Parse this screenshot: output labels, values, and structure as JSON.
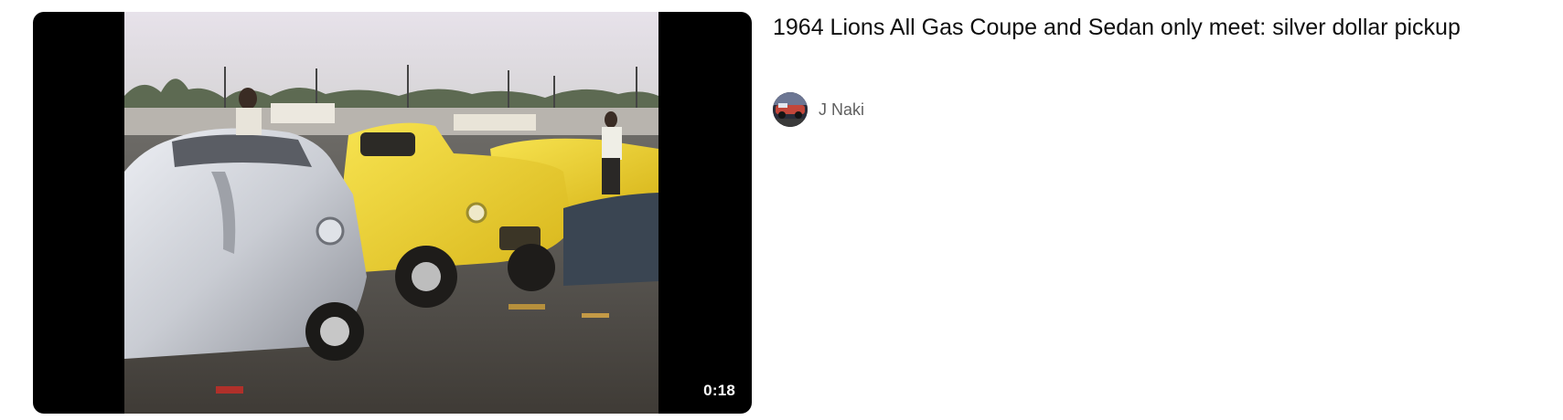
{
  "video": {
    "title": "1964 Lions All Gas Coupe and Sedan only meet: silver dollar pickup",
    "duration": "0:18",
    "channel_name": "J Naki",
    "thumbnail_icon": "vintage-drag-cars-photo",
    "avatar_icon": "channel-avatar-photo"
  },
  "colors": {
    "title_text": "#0f0f0f",
    "channel_text": "#606060",
    "badge_bg": "#000000",
    "badge_text": "#ffffff"
  }
}
